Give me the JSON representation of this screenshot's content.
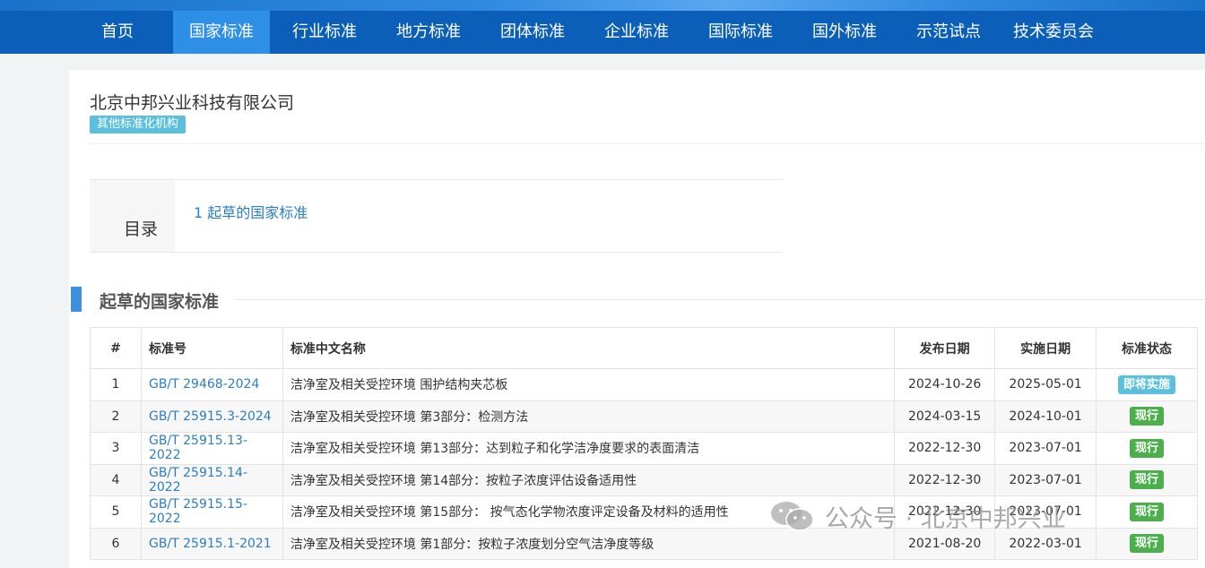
{
  "nav": {
    "items": [
      {
        "label": "首页"
      },
      {
        "label": "国家标准",
        "active": true
      },
      {
        "label": "行业标准"
      },
      {
        "label": "地方标准"
      },
      {
        "label": "团体标准"
      },
      {
        "label": "企业标准"
      },
      {
        "label": "国际标准"
      },
      {
        "label": "国外标准"
      },
      {
        "label": "示范试点"
      },
      {
        "label": "技术委员会"
      }
    ]
  },
  "company": {
    "name": "北京中邦兴业科技有限公司",
    "badge": "其他标准化机构"
  },
  "toc": {
    "label": "目录",
    "items": [
      "1  起草的国家标准"
    ]
  },
  "section": {
    "title": "起草的国家标准"
  },
  "table": {
    "headers": [
      "#",
      "标准号",
      "标准中文名称",
      "发布日期",
      "实施日期",
      "标准状态"
    ],
    "rows": [
      {
        "num": "1",
        "code": "GB/T 29468-2024",
        "name": "洁净室及相关受控环境 围护结构夹芯板",
        "published": "2024-10-26",
        "implemented": "2025-05-01",
        "status": "即将实施"
      },
      {
        "num": "2",
        "code": "GB/T 25915.3-2024",
        "name": "洁净室及相关受控环境 第3部分：检测方法",
        "published": "2024-03-15",
        "implemented": "2024-10-01",
        "status": "现行"
      },
      {
        "num": "3",
        "code": "GB/T 25915.13-2022",
        "name": "洁净室及相关受控环境 第13部分：达到粒子和化学洁净度要求的表面清洁",
        "published": "2022-12-30",
        "implemented": "2023-07-01",
        "status": "现行"
      },
      {
        "num": "4",
        "code": "GB/T 25915.14-2022",
        "name": "洁净室及相关受控环境 第14部分：按粒子浓度评估设备适用性",
        "published": "2022-12-30",
        "implemented": "2023-07-01",
        "status": "现行"
      },
      {
        "num": "5",
        "code": "GB/T 25915.15-2022",
        "name": "洁净室及相关受控环境 第15部分： 按气态化学物浓度评定设备及材料的适用性",
        "published": "2022-12-30",
        "implemented": "2023-07-01",
        "status": "现行"
      },
      {
        "num": "6",
        "code": "GB/T 25915.1-2021",
        "name": "洁净室及相关受控环境 第1部分：按粒子浓度划分空气洁净度等级",
        "published": "2021-08-20",
        "implemented": "2022-03-01",
        "status": "现行"
      }
    ]
  },
  "watermark": {
    "text": "公众号 · 北京中邦兴业",
    "icon": "wechat-icon"
  },
  "colors": {
    "nav_bg": "#0b5fb8",
    "nav_active": "#2e8fe6",
    "link": "#2b7ec2",
    "badge_upcoming": "#5bc0de",
    "badge_current": "#4cae4c"
  }
}
